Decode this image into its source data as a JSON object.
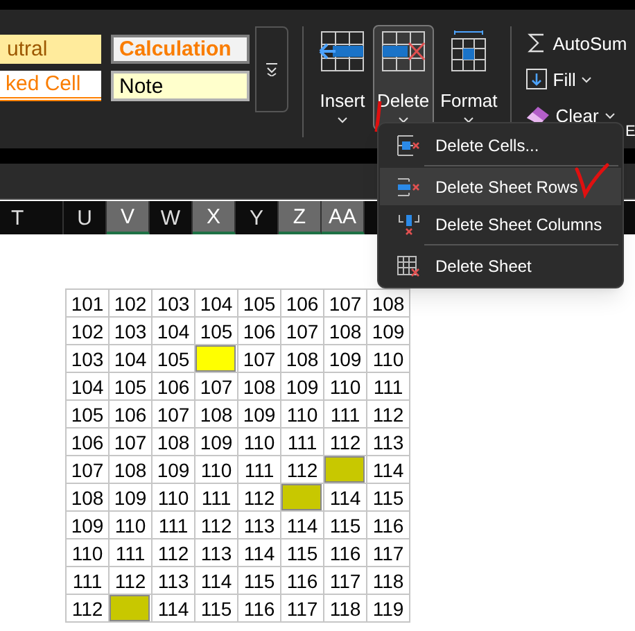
{
  "cell_styles": [
    {
      "label": "utral",
      "kind": "neutral"
    },
    {
      "label": "Calculation",
      "kind": "calculation"
    },
    {
      "label": "ked Cell",
      "kind": "linked"
    },
    {
      "label": "Note",
      "kind": "note"
    }
  ],
  "cells_group": [
    {
      "label": "Insert",
      "kind": "insert",
      "selected": false
    },
    {
      "label": "Delete",
      "kind": "delete",
      "selected": true
    },
    {
      "label": "Format",
      "kind": "format",
      "selected": false
    }
  ],
  "editing_group": [
    {
      "label": "AutoSum",
      "kind": "sum",
      "dropdown": false
    },
    {
      "label": "Fill",
      "kind": "fill",
      "dropdown": true
    },
    {
      "label": "Clear",
      "kind": "clear",
      "dropdown": true
    }
  ],
  "edge_letter": "E",
  "column_headers": [
    {
      "label": "T",
      "selected": false
    },
    {
      "label": "U",
      "selected": false
    },
    {
      "label": "V",
      "selected": true
    },
    {
      "label": "W",
      "selected": false
    },
    {
      "label": "X",
      "selected": true
    },
    {
      "label": "Y",
      "selected": false
    },
    {
      "label": "Z",
      "selected": true
    },
    {
      "label": "AA",
      "selected": true
    }
  ],
  "delete_menu": [
    {
      "label": "Delete Cells...",
      "kind": "cells",
      "selected": false
    },
    {
      "label": "Delete Sheet Rows",
      "kind": "rows",
      "selected": true
    },
    {
      "label": "Delete Sheet Columns",
      "kind": "columns",
      "selected": false
    },
    {
      "label": "Delete Sheet",
      "kind": "sheet",
      "selected": false
    }
  ],
  "grid": [
    [
      {
        "text": "101"
      },
      {
        "text": "102"
      },
      {
        "text": "103"
      },
      {
        "text": "104"
      },
      {
        "text": "105"
      },
      {
        "text": "106"
      },
      {
        "text": "107"
      },
      {
        "text": "108"
      }
    ],
    [
      {
        "text": "102"
      },
      {
        "text": "103"
      },
      {
        "text": "104"
      },
      {
        "text": "105"
      },
      {
        "text": "106"
      },
      {
        "text": "107"
      },
      {
        "text": "108"
      },
      {
        "text": "109"
      }
    ],
    [
      {
        "text": "103"
      },
      {
        "text": "104"
      },
      {
        "text": "105"
      },
      {
        "color": "#ffff00"
      },
      {
        "text": "107"
      },
      {
        "text": "108"
      },
      {
        "text": "109"
      },
      {
        "text": "110"
      }
    ],
    [
      {
        "text": "104"
      },
      {
        "text": "105"
      },
      {
        "text": "106"
      },
      {
        "text": "107"
      },
      {
        "text": "108"
      },
      {
        "text": "109"
      },
      {
        "text": "110"
      },
      {
        "text": "111"
      }
    ],
    [
      {
        "text": "105"
      },
      {
        "text": "106"
      },
      {
        "text": "107"
      },
      {
        "text": "108"
      },
      {
        "text": "109"
      },
      {
        "text": "110"
      },
      {
        "text": "111"
      },
      {
        "text": "112"
      }
    ],
    [
      {
        "text": "106"
      },
      {
        "text": "107"
      },
      {
        "text": "108"
      },
      {
        "text": "109"
      },
      {
        "text": "110"
      },
      {
        "text": "111"
      },
      {
        "text": "112"
      },
      {
        "text": "113"
      }
    ],
    [
      {
        "text": "107"
      },
      {
        "text": "108"
      },
      {
        "text": "109"
      },
      {
        "text": "110"
      },
      {
        "text": "111"
      },
      {
        "text": "112"
      },
      {
        "color": "#c8c800"
      },
      {
        "text": "114"
      }
    ],
    [
      {
        "text": "108"
      },
      {
        "text": "109"
      },
      {
        "text": "110"
      },
      {
        "text": "111"
      },
      {
        "text": "112"
      },
      {
        "color": "#c8c800"
      },
      {
        "text": "114"
      },
      {
        "text": "115"
      }
    ],
    [
      {
        "text": "109"
      },
      {
        "text": "110"
      },
      {
        "text": "111"
      },
      {
        "text": "112"
      },
      {
        "text": "113"
      },
      {
        "text": "114"
      },
      {
        "text": "115"
      },
      {
        "text": "116"
      }
    ],
    [
      {
        "text": "110"
      },
      {
        "text": "111"
      },
      {
        "text": "112"
      },
      {
        "text": "113"
      },
      {
        "text": "114"
      },
      {
        "text": "115"
      },
      {
        "text": "116"
      },
      {
        "text": "117"
      }
    ],
    [
      {
        "text": "111"
      },
      {
        "text": "112"
      },
      {
        "text": "113"
      },
      {
        "text": "114"
      },
      {
        "text": "115"
      },
      {
        "text": "116"
      },
      {
        "text": "117"
      },
      {
        "text": "118"
      }
    ],
    [
      {
        "text": "112"
      },
      {
        "color": "#c8c800"
      },
      {
        "text": "114"
      },
      {
        "text": "115"
      },
      {
        "text": "116"
      },
      {
        "text": "117"
      },
      {
        "text": "118"
      },
      {
        "text": "119"
      }
    ]
  ]
}
